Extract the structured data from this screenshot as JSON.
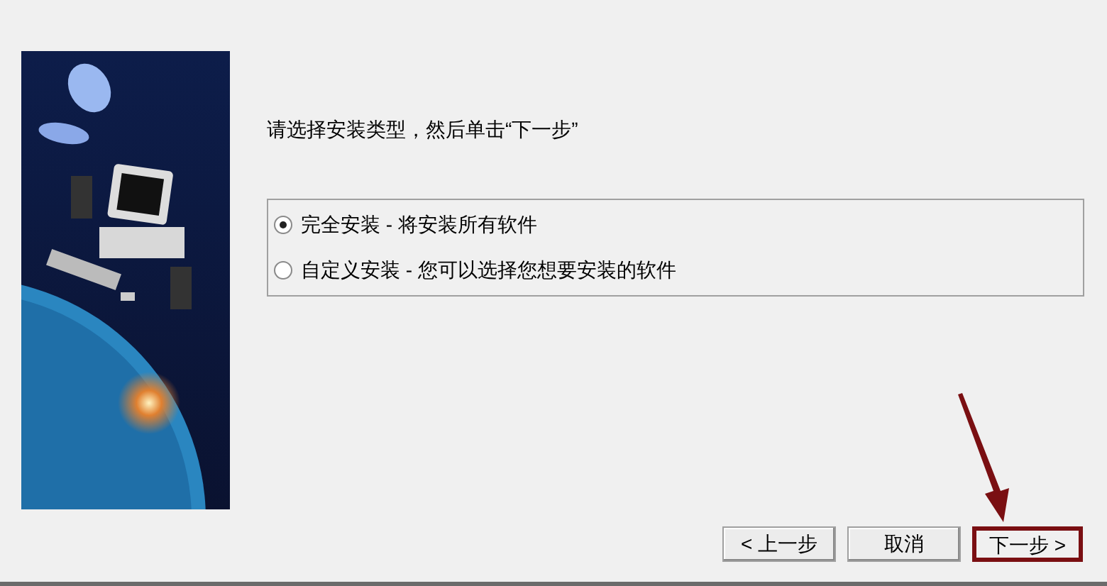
{
  "instruction": "请选择安装类型，然后单击“下一步”",
  "install_types": [
    {
      "label": "完全安装 - 将安装所有软件",
      "selected": true
    },
    {
      "label": "自定义安装 - 您可以选择您想要安装的软件",
      "selected": false
    }
  ],
  "buttons": [
    {
      "label": "< 上一步",
      "highlighted": false
    },
    {
      "label": "取消",
      "highlighted": false
    },
    {
      "label": "下一步 >",
      "highlighted": true
    }
  ]
}
